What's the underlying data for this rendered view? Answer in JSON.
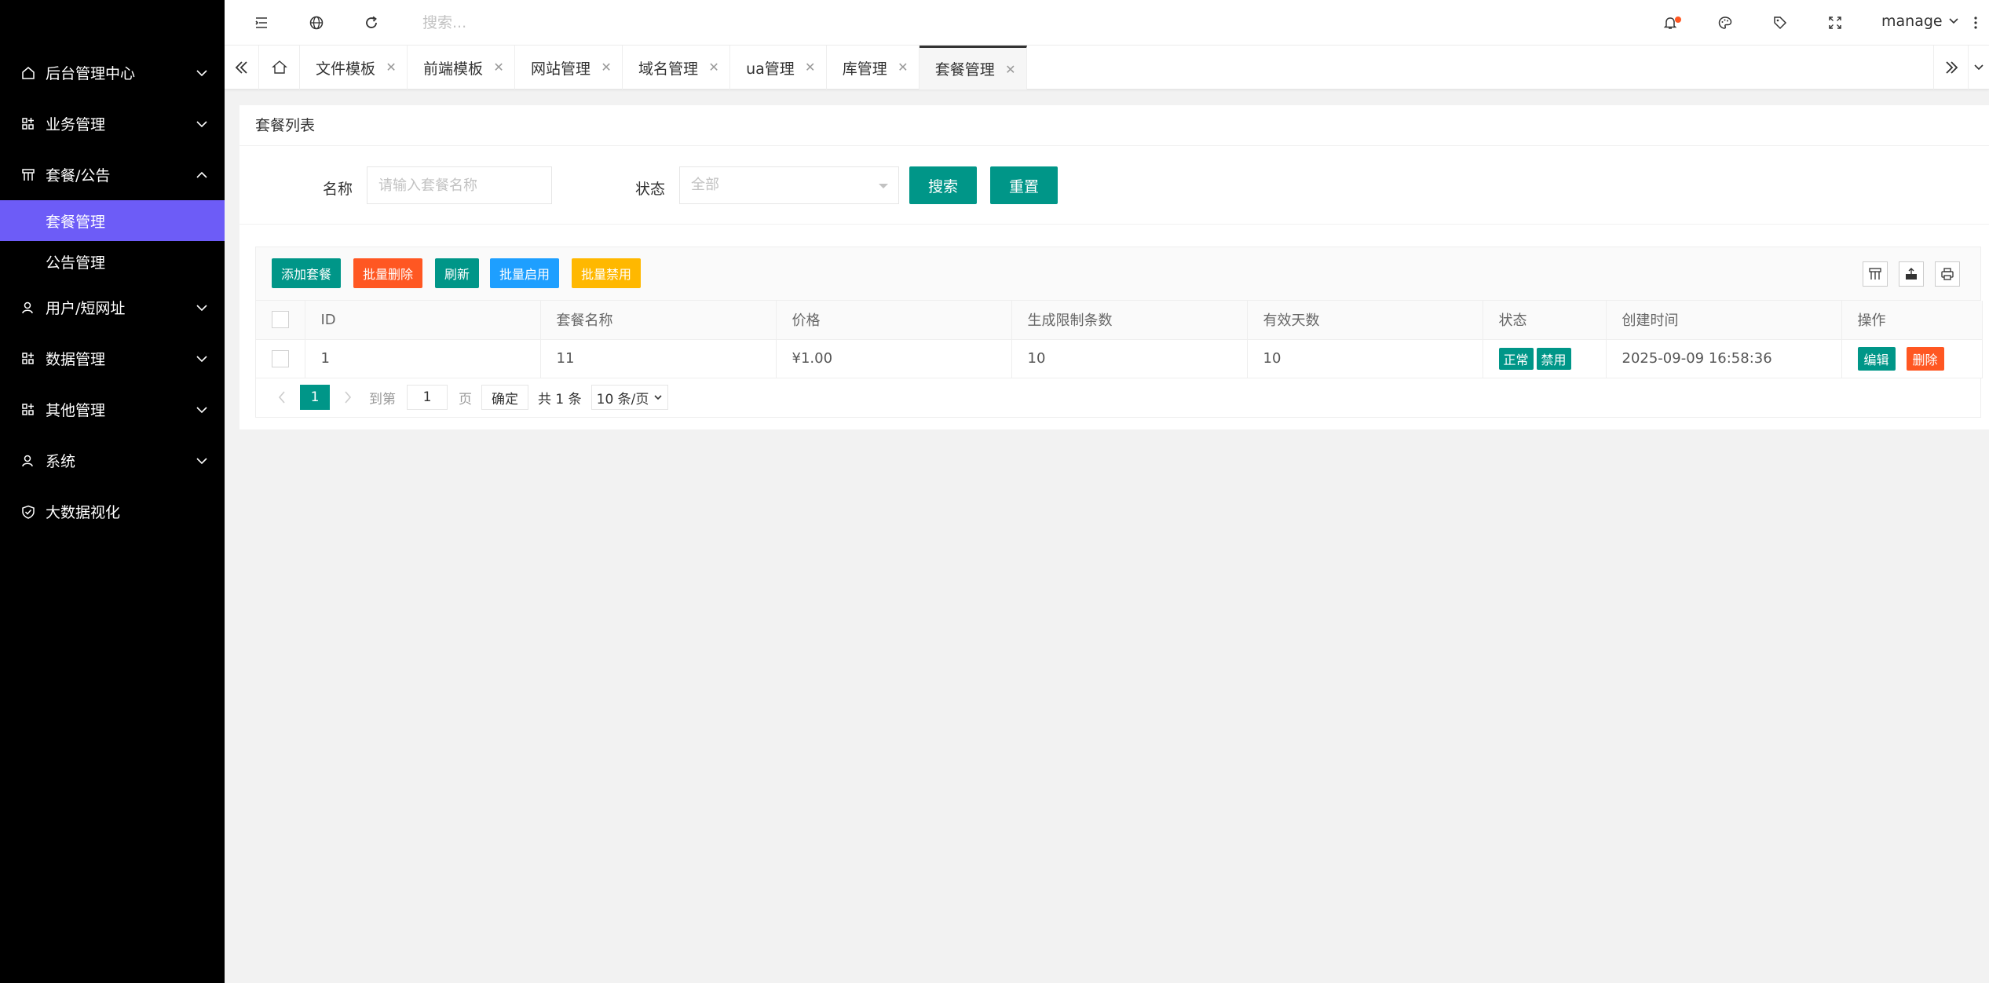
{
  "sidebar": {
    "menu": [
      {
        "label": "后台管理中心",
        "icon": "home-icon",
        "expanded": false
      },
      {
        "label": "业务管理",
        "icon": "apps-icon",
        "expanded": false
      },
      {
        "label": "套餐/公告",
        "icon": "template-icon",
        "expanded": true
      },
      {
        "label": "用户/短网址",
        "icon": "user-icon",
        "expanded": false
      },
      {
        "label": "数据管理",
        "icon": "apps-icon",
        "expanded": false
      },
      {
        "label": "其他管理",
        "icon": "apps-icon",
        "expanded": false
      },
      {
        "label": "系统",
        "icon": "user-icon",
        "expanded": false
      },
      {
        "label": "大数据视化",
        "icon": "shield-icon",
        "expanded": false
      }
    ],
    "submenu": [
      {
        "label": "套餐管理",
        "active": true
      },
      {
        "label": "公告管理",
        "active": false
      }
    ],
    "active_color": "#6d5cf7"
  },
  "header": {
    "search_placeholder": "搜索...",
    "user_name": "manage"
  },
  "tabs": [
    {
      "label": "文件模板"
    },
    {
      "label": "前端模板"
    },
    {
      "label": "网站管理"
    },
    {
      "label": "域名管理"
    },
    {
      "label": "ua管理"
    },
    {
      "label": "库管理"
    },
    {
      "label": "套餐管理",
      "active": true
    }
  ],
  "card": {
    "title": "套餐列表",
    "filter": {
      "name_label": "名称",
      "name_placeholder": "请输入套餐名称",
      "status_label": "状态",
      "status_value": "全部",
      "search_label": "搜索",
      "reset_label": "重置"
    },
    "toolbar": {
      "add_label": "添加套餐",
      "batch_delete_label": "批量删除",
      "refresh_label": "刷新",
      "batch_enable_label": "批量启用",
      "batch_disable_label": "批量禁用"
    },
    "table": {
      "columns": [
        "ID",
        "套餐名称",
        "价格",
        "生成限制条数",
        "有效天数",
        "状态",
        "创建时间",
        "操作"
      ],
      "rows": [
        {
          "id": "1",
          "name": "11",
          "price": "¥1.00",
          "limit": "10",
          "days": "10",
          "status_on": "正常",
          "status_off": "禁用",
          "created": "2025-09-09 16:58:36",
          "edit": "编辑",
          "delete": "删除"
        }
      ]
    },
    "pager": {
      "current": "1",
      "goto_prefix": "到第",
      "goto_value": "1",
      "goto_suffix": "页",
      "ok_label": "确定",
      "total": "共 1 条",
      "page_size": "10 条/页"
    }
  },
  "colors": {
    "primary": "#009688",
    "danger": "#ff5722",
    "info": "#1e9fff",
    "warning": "#ffb800"
  }
}
